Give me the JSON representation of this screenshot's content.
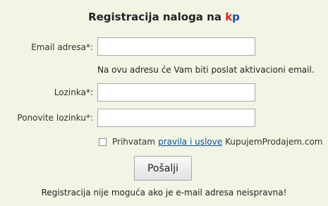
{
  "form": {
    "title": "Registracija naloga na",
    "brand_k": "k",
    "brand_p": "p",
    "email_label": "Email adresa*:",
    "email_value": "",
    "email_hint": "Na ovu adresu će Vam biti poslat aktivacioni email.",
    "password_label": "Lozinka*:",
    "password_value": "",
    "repeat_password_label": "Ponovite lozinku*:",
    "repeat_password_value": "",
    "terms_checked": false,
    "terms_prefix": "Prihvatam",
    "terms_link": "pravila i uslove",
    "terms_suffix": "KupujemProdajem.com",
    "submit_label": "Pošalji",
    "footer_note": "Registracija nije moguća ako je e-mail adresa neispravna!"
  },
  "colors": {
    "background": "#f2f4e4",
    "brand_k": "#d9261c",
    "brand_p": "#1f4fa0",
    "link": "#0b4fa8"
  }
}
